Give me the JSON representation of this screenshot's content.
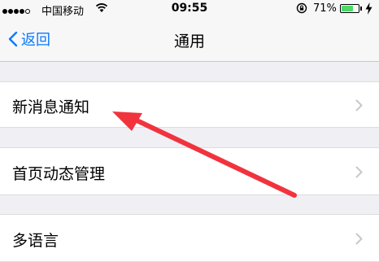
{
  "status_bar": {
    "carrier": "中国移动",
    "time": "09:55",
    "battery_percent": "71%",
    "battery_level": 0.71,
    "signal_bars": 4,
    "signal_total": 5
  },
  "nav": {
    "back_label": "返回",
    "title": "通用"
  },
  "settings": {
    "items": [
      {
        "label": "新消息通知"
      },
      {
        "label": "首页动态管理"
      },
      {
        "label": "多语言"
      }
    ]
  },
  "annotation": {
    "color": "#f1333e",
    "icon": "red-arrow-pointer"
  },
  "colors": {
    "accent": "#0a7aff",
    "battery": "#4cd964",
    "background": "#efeff4"
  }
}
